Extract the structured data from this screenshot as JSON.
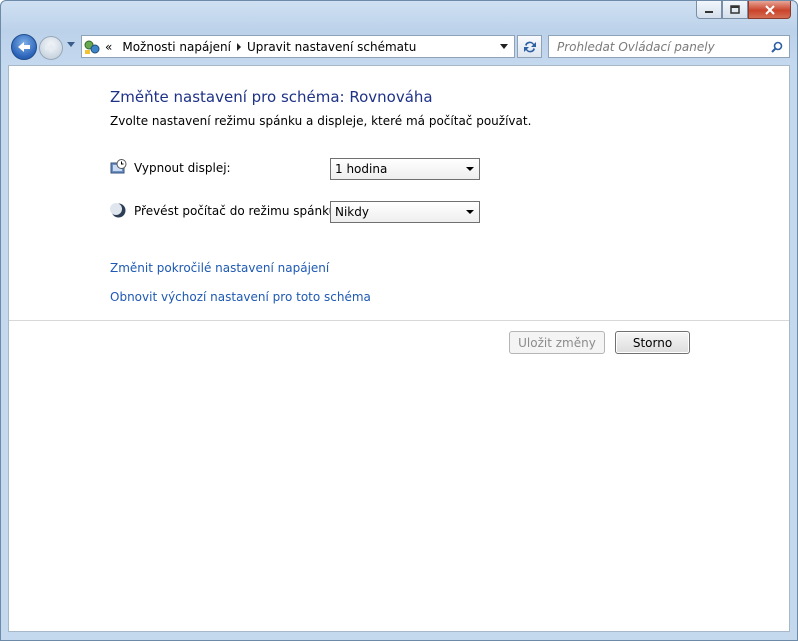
{
  "window": {
    "buttons": {
      "minimize": "minimize",
      "maximize": "maximize",
      "close": "close"
    }
  },
  "nav": {
    "breadcrumb_overflow": "«",
    "breadcrumbs": [
      "Možnosti napájení",
      "Upravit nastavení schématu"
    ],
    "search_placeholder": "Prohledat Ovládací panely"
  },
  "main": {
    "title": "Změňte nastavení pro schéma: Rovnováha",
    "subtitle": "Zvolte nastavení režimu spánku a displeje, které má počítač používat.",
    "settings": [
      {
        "label": "Vypnout displej:",
        "value": "1 hodina",
        "icon": "display-clock-icon"
      },
      {
        "label": "Převést počítač do režimu spánku:",
        "value": "Nikdy",
        "icon": "sleep-moon-icon"
      }
    ],
    "links": [
      "Změnit pokročilé nastavení napájení",
      "Obnovit výchozí nastavení pro toto schéma"
    ],
    "buttons": {
      "save": "Uložit změny",
      "cancel": "Storno"
    }
  },
  "colors": {
    "title": "#1e3287",
    "link": "#1e59b3"
  }
}
